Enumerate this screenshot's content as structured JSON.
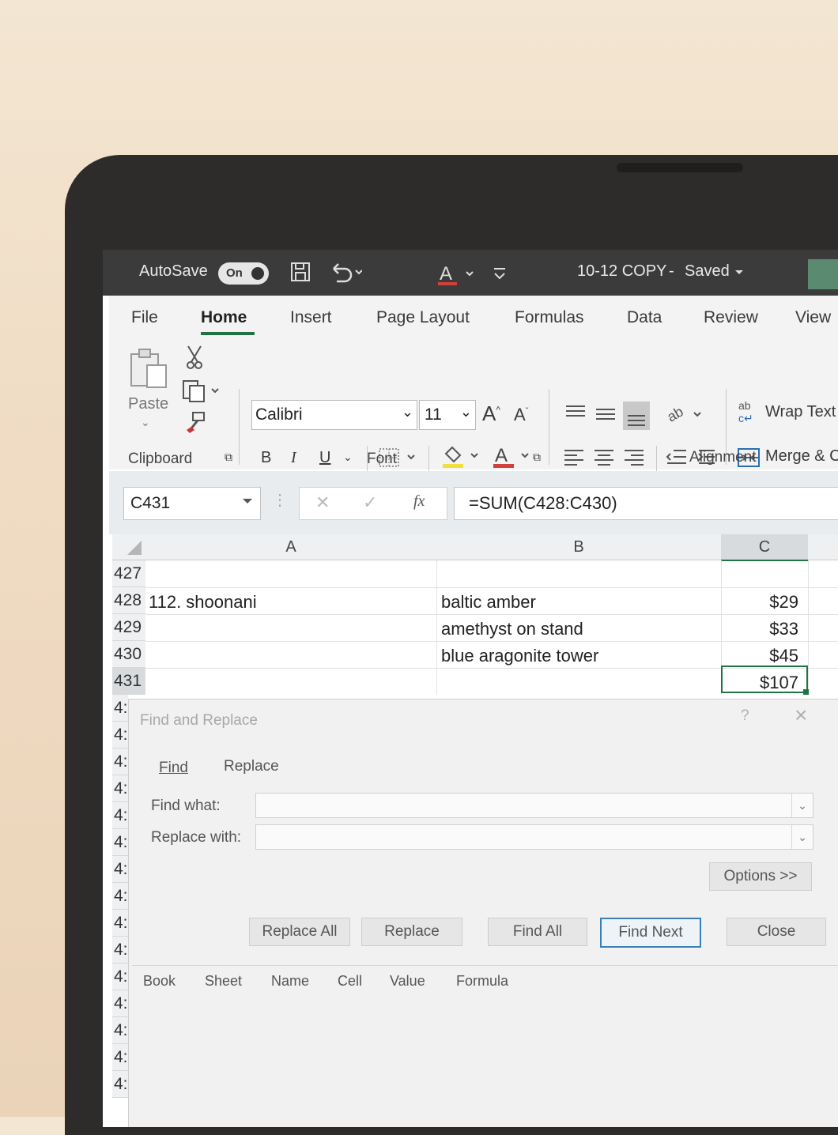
{
  "titlebar": {
    "autosave_label": "AutoSave",
    "autosave_state": "On",
    "document_title": "10-12 COPY",
    "separator": "-",
    "save_status": "Saved"
  },
  "tabs": [
    "File",
    "Home",
    "Insert",
    "Page Layout",
    "Formulas",
    "Data",
    "Review",
    "View"
  ],
  "ribbon": {
    "paste_label": "Paste",
    "font_name": "Calibri",
    "font_size": "11",
    "bold": "B",
    "italic": "I",
    "underline": "U",
    "wrap_text": "Wrap Text",
    "merge": "Merge & C",
    "groups": {
      "clipboard": "Clipboard",
      "font": "Font",
      "alignment": "Alignment"
    }
  },
  "formula_bar": {
    "name_box": "C431",
    "fx_label": "fx",
    "formula": "=SUM(C428:C430)"
  },
  "grid": {
    "columns": [
      "A",
      "B",
      "C"
    ],
    "rows": [
      {
        "num": "427",
        "a": "",
        "b": "",
        "c": ""
      },
      {
        "num": "428",
        "a": "112. shoonani",
        "b": "baltic amber",
        "c": "$29"
      },
      {
        "num": "429",
        "a": "",
        "b": "amethyst on stand",
        "c": "$33"
      },
      {
        "num": "430",
        "a": "",
        "b": "blue aragonite tower",
        "c": "$45"
      },
      {
        "num": "431",
        "a": "",
        "b": "",
        "c": "$107"
      }
    ],
    "partial_row_labels": [
      "4:",
      "4:",
      "4:",
      "4:",
      "4:",
      "4:",
      "4:",
      "4:",
      "4:",
      "4:",
      "4:",
      "4:",
      "4:",
      "4:",
      "4:"
    ]
  },
  "dialog": {
    "title": "Find and Replace",
    "help": "?",
    "close_x": "×",
    "tab_find": "Find",
    "tab_replace": "Replace",
    "find_what_label": "Find what:",
    "replace_with_label": "Replace with:",
    "options_button": "Options >>",
    "buttons": {
      "replace_all": "Replace All",
      "replace": "Replace",
      "find_all": "Find All",
      "find_next": "Find Next",
      "close": "Close"
    },
    "result_headers": [
      "Book",
      "Sheet",
      "Name",
      "Cell",
      "Value",
      "Formula"
    ]
  }
}
